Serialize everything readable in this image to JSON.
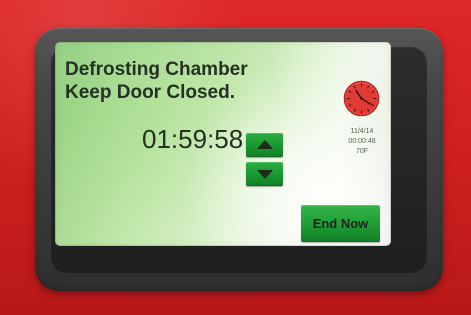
{
  "screen": {
    "status_line_1": "Defrosting Chamber",
    "status_line_2": "Keep Door Closed.",
    "timer_value": "01:59:58",
    "date": "11/4/14",
    "elapsed_time": "00:00:48",
    "temperature": "70F",
    "end_button_label": "End Now",
    "clock_icon": "analog-clock-icon",
    "up_icon": "up-arrow-icon",
    "down_icon": "down-arrow-icon"
  },
  "colors": {
    "housing_red": "#d11f1f",
    "bezel": "#3a3a3a",
    "screen_green": "#b6e39d",
    "button_green": "#1c9a34",
    "clock_red": "#e13a35",
    "text_dark": "#253124"
  }
}
